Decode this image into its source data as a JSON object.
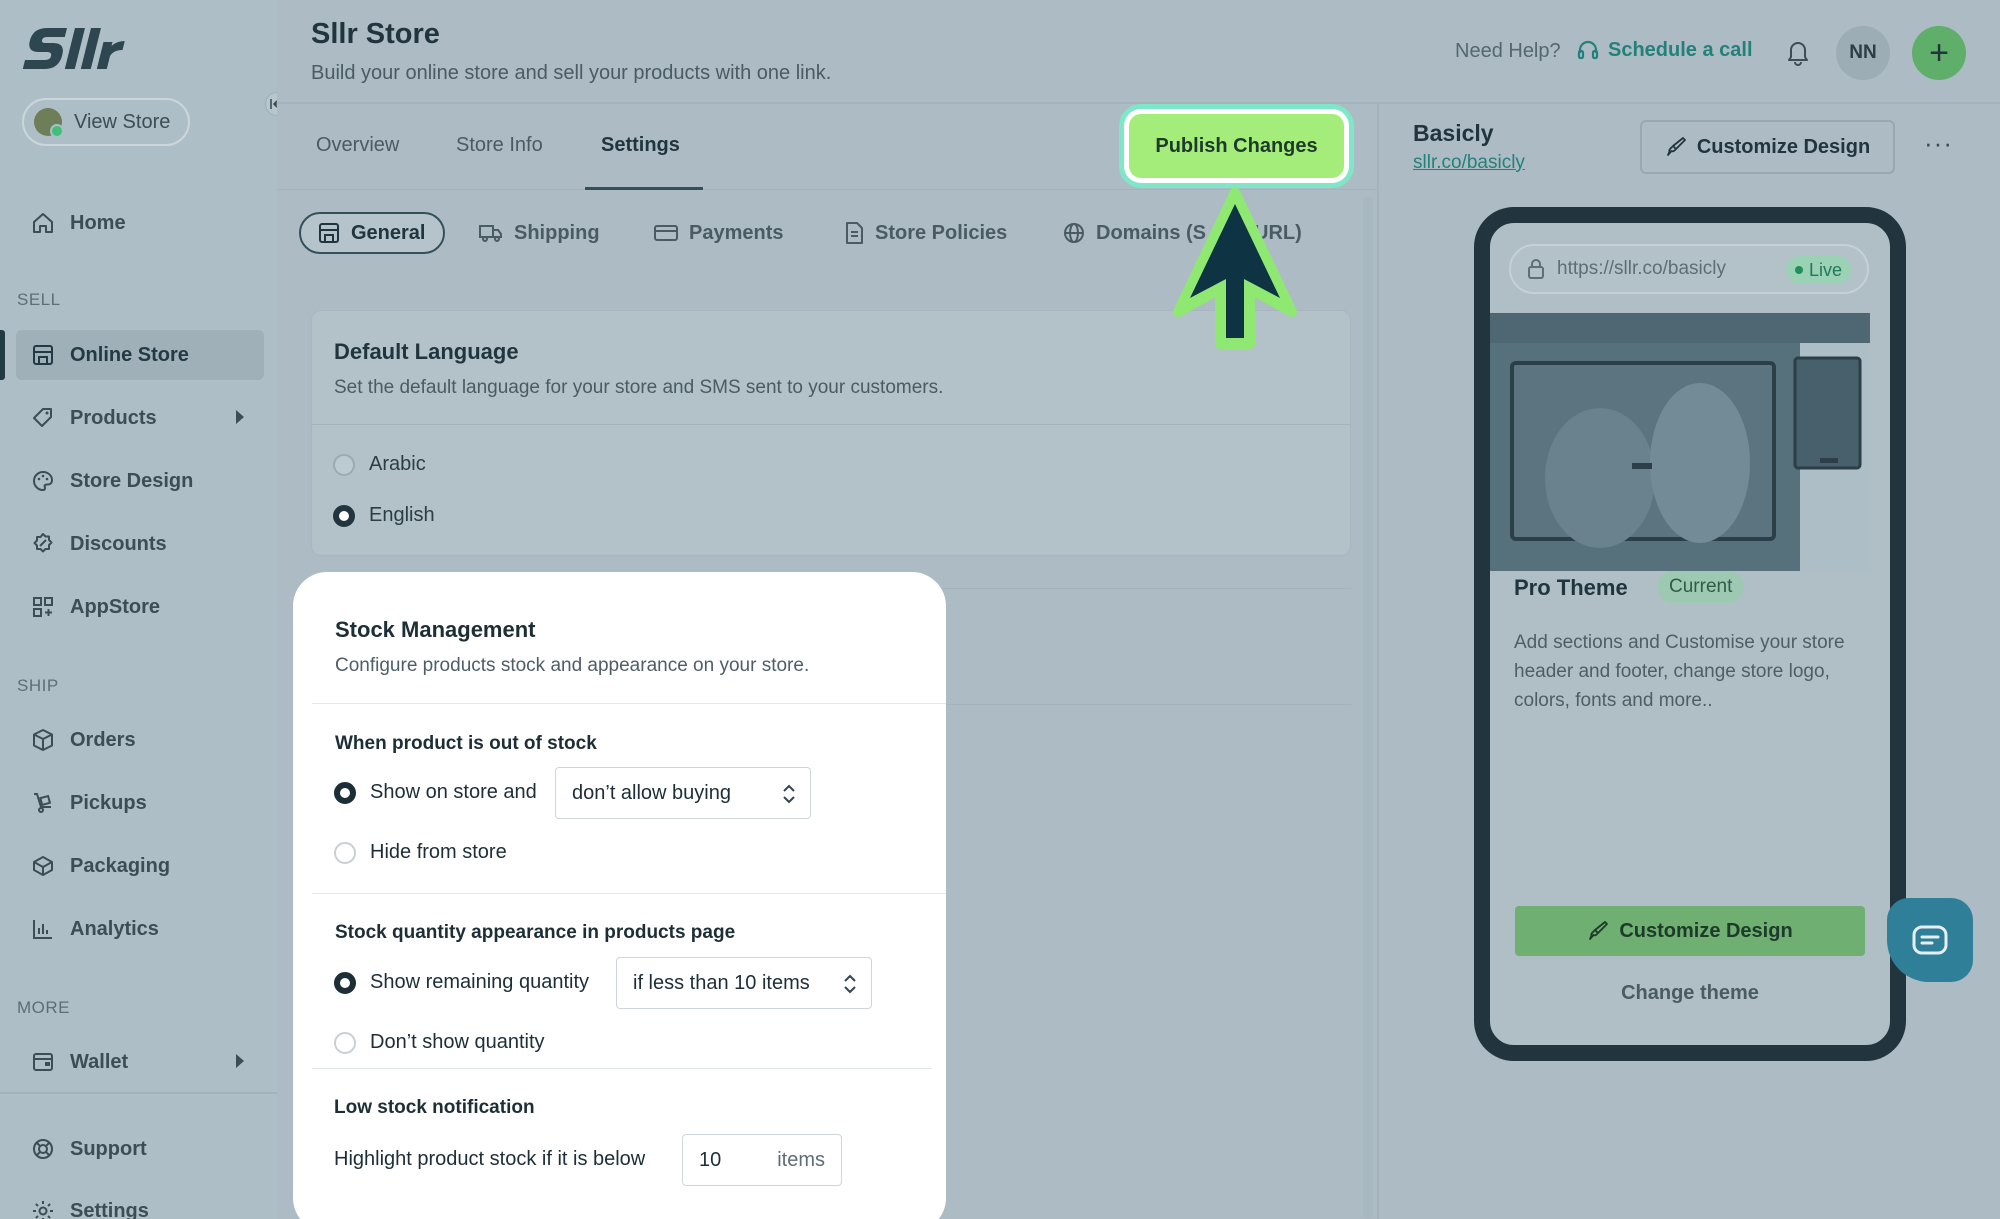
{
  "brand": {
    "logo_text": "Sllr"
  },
  "sidebar": {
    "view_store": "View Store",
    "home": "Home",
    "sections": {
      "sell": "SELL",
      "ship": "SHIP",
      "more": "MORE"
    },
    "items": {
      "online_store": "Online Store",
      "products": "Products",
      "store_design": "Store Design",
      "discounts": "Discounts",
      "appstore": "AppStore",
      "orders": "Orders",
      "pickups": "Pickups",
      "packaging": "Packaging",
      "analytics": "Analytics",
      "wallet": "Wallet",
      "support": "Support",
      "settings": "Settings"
    }
  },
  "header": {
    "title": "Sllr Store",
    "subtitle": "Build your online store and sell your products with one link.",
    "need_help": "Need Help?",
    "schedule": "Schedule a call",
    "avatar": "NN",
    "plus": "+"
  },
  "tabs": {
    "overview": "Overview",
    "store_info": "Store Info",
    "settings": "Settings"
  },
  "publish": {
    "label": "Publish Changes"
  },
  "subtabs": {
    "general": "General",
    "shipping": "Shipping",
    "payments": "Payments",
    "store_policies": "Store Policies",
    "domains_left": "Domains (S",
    "domains_right": "URL)"
  },
  "default_language": {
    "title": "Default Language",
    "subtitle": "Set the default language for your store and SMS sent to your customers.",
    "options": [
      "Arabic",
      "English"
    ],
    "selected": "English"
  },
  "stock_management": {
    "title": "Stock Management",
    "subtitle": "Configure products stock and appearance on your store.",
    "out_of_stock": {
      "title": "When product is out of stock",
      "option_show": "Show on store and",
      "select_value": "don’t allow buying",
      "option_hide": "Hide from store"
    },
    "quantity_appearance": {
      "title": "Stock quantity appearance in products page",
      "option_show": "Show remaining quantity",
      "select_value": "if less than 10 items",
      "option_hide": "Don’t show quantity"
    },
    "low_stock": {
      "title": "Low stock notification",
      "label": "Highlight product stock if it is below",
      "value": "10",
      "unit": "items"
    }
  },
  "preview": {
    "store_name": "Basicly",
    "store_link": "sllr.co/basicly",
    "customize_top": "Customize Design",
    "more": "···",
    "url": "https://sllr.co/basicly",
    "live": "Live",
    "theme_name": "Pro Theme",
    "current": "Current",
    "description": "Add sections and Customise your store header and footer, change store logo, colors, fonts and more..",
    "customize_btn": "Customize Design",
    "change_theme": "Change theme"
  },
  "colors": {
    "accent": "#24807a",
    "publish_bg": "#a4ed7a",
    "highlight_ring": "#7fe7c8",
    "dark": "#22353e"
  }
}
